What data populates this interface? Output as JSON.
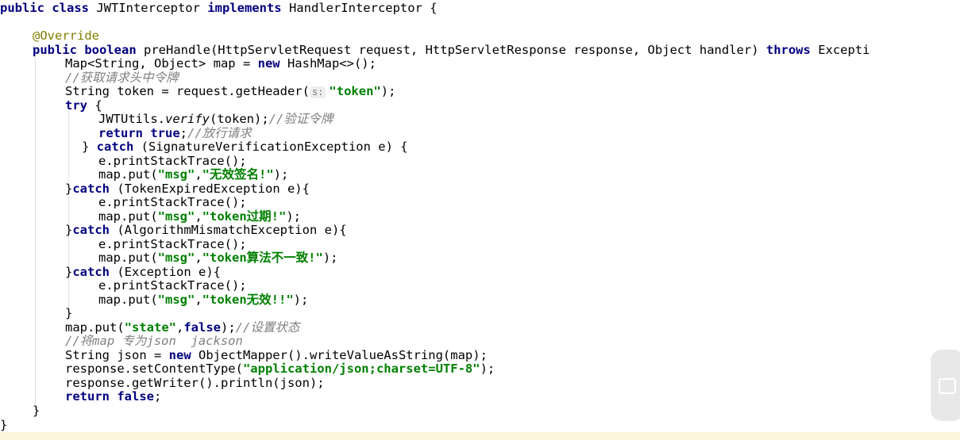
{
  "code": {
    "l1": {
      "kw1": "public class",
      "t1": " JWTInterceptor ",
      "kw2": "implements",
      "t2": " HandlerInterceptor {"
    },
    "l2": {
      "ann": "@Override"
    },
    "l3": {
      "kw1": "public boolean",
      "t1": " preHandle(HttpServletRequest request, HttpServletResponse response, Object handler) ",
      "kw2": "throws",
      "t2": " Excepti"
    },
    "l4": {
      "t1": "Map<String, Object> map = ",
      "kw1": "new",
      "t2": " HashMap<>();"
    },
    "l5": {
      "cm": "//获取请求头中令牌"
    },
    "l6": {
      "t1": "String token = request.getHeader(",
      "hint": "s:",
      "str": "\"token\"",
      "t2": ");"
    },
    "l7": {
      "kw1": "try",
      "t1": " {"
    },
    "l8": {
      "t1": "JWTUtils.",
      "it": "verify",
      "t2": "(token);",
      "cm": "//验证令牌"
    },
    "l9": {
      "kw1": "return true",
      "t1": ";",
      "cm": "//放行请求"
    },
    "l10": {
      "t1": "} ",
      "kw1": "catch",
      "t2": " (SignatureVerificationException e) {"
    },
    "l11": {
      "t1": "e.printStackTrace();"
    },
    "l12": {
      "t1": "map.put(",
      "str1": "\"msg\"",
      "t2": ",",
      "str2": "\"无效签名!\"",
      "t3": ");"
    },
    "l13": {
      "t1": "}",
      "kw1": "catch",
      "t2": " (TokenExpiredException e){"
    },
    "l14": {
      "t1": "e.printStackTrace();"
    },
    "l15": {
      "t1": "map.put(",
      "str1": "\"msg\"",
      "t2": ",",
      "str2": "\"token过期!\"",
      "t3": ");"
    },
    "l16": {
      "t1": "}",
      "kw1": "catch",
      "t2": " (AlgorithmMismatchException e){"
    },
    "l17": {
      "t1": "e.printStackTrace();"
    },
    "l18": {
      "t1": "map.put(",
      "str1": "\"msg\"",
      "t2": ",",
      "str2": "\"token算法不一致!\"",
      "t3": ");"
    },
    "l19": {
      "t1": "}",
      "kw1": "catch",
      "t2": " (Exception e){"
    },
    "l20": {
      "t1": "e.printStackTrace();"
    },
    "l21": {
      "t1": "map.put(",
      "str1": "\"msg\"",
      "t2": ",",
      "str2": "\"token无效!!\"",
      "t3": ");"
    },
    "l22": {
      "t1": "}"
    },
    "l23": {
      "t1": "map.put(",
      "str1": "\"state\"",
      "t2": ",",
      "kw1": "false",
      "t3": ");",
      "cm": "//设置状态"
    },
    "l24": {
      "cm": "//将map 专为json  jackson"
    },
    "l25": {
      "t1": "String json = ",
      "kw1": "new",
      "t2": " ObjectMapper().writeValueAsString(map);"
    },
    "l26": {
      "t1": "response.setContentType(",
      "str": "\"application/json;charset=UTF-8\"",
      "t2": ");"
    },
    "l27": {
      "t1": "response.getWriter().println(json);"
    },
    "l28": {
      "kw1": "return false",
      "t1": ";"
    },
    "l29": {
      "t1": "}"
    },
    "l30": {
      "t1": "}"
    }
  },
  "colors": {
    "keyword": "#000080",
    "annotation": "#808000",
    "comment": "#808080",
    "string": "#008000",
    "background": "#ffffff",
    "bottom_strip": "#fdf6dc"
  },
  "icons": {
    "side_bubble": "chat-bubble-icon"
  }
}
